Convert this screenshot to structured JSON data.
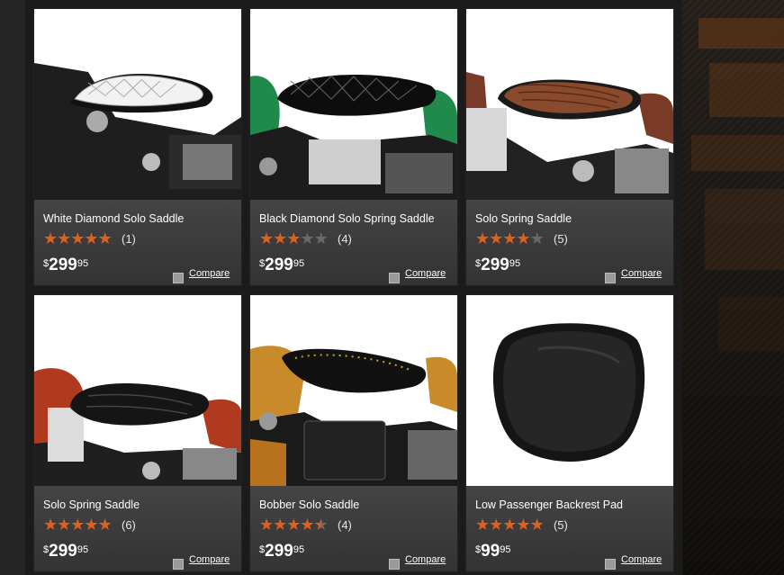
{
  "products": [
    {
      "name": "White Diamond Solo Saddle",
      "rating": 5,
      "reviews": "(1)",
      "currency": "$",
      "price": "299",
      "cents": "95",
      "compare_label": "Compare"
    },
    {
      "name": "Black Diamond Solo Spring Saddle",
      "rating": 3,
      "reviews": "(4)",
      "currency": "$",
      "price": "299",
      "cents": "95",
      "compare_label": "Compare"
    },
    {
      "name": "Solo Spring Saddle",
      "rating": 4,
      "reviews": "(5)",
      "currency": "$",
      "price": "299",
      "cents": "95",
      "compare_label": "Compare"
    },
    {
      "name": "Solo Spring Saddle",
      "rating": 5,
      "reviews": "(6)",
      "currency": "$",
      "price": "299",
      "cents": "95",
      "compare_label": "Compare"
    },
    {
      "name": "Bobber Solo Saddle",
      "rating": 4.5,
      "reviews": "(4)",
      "currency": "$",
      "price": "299",
      "cents": "95",
      "compare_label": "Compare"
    },
    {
      "name": "Low Passenger Backrest Pad",
      "rating": 5,
      "reviews": "(5)",
      "currency": "$",
      "price": "99",
      "cents": "95",
      "compare_label": "Compare"
    }
  ],
  "colors": {
    "star_on": "#e0601a",
    "star_off": "#6a6a6a",
    "card_bg": "#343434"
  }
}
